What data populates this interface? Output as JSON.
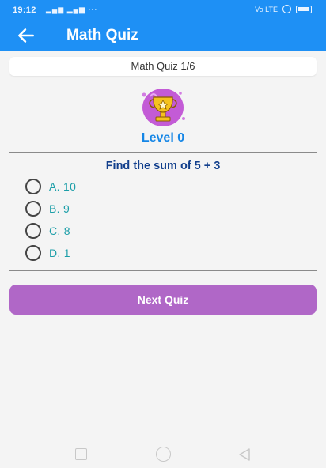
{
  "status_bar": {
    "time": "19:12",
    "network": "Vo LTE"
  },
  "app_bar": {
    "title": "Math Quiz"
  },
  "progress": {
    "label": "Math Quiz 1/6"
  },
  "level": {
    "label": "Level 0"
  },
  "question": {
    "text": "Find the sum of 5 + 3"
  },
  "options": [
    {
      "label": "A. 10"
    },
    {
      "label": "B. 9"
    },
    {
      "label": "C. 8"
    },
    {
      "label": "D. 1"
    }
  ],
  "next_button": {
    "label": "Next Quiz"
  },
  "colors": {
    "primary": "#1e90f5",
    "level": "#1586e6",
    "question": "#123f8c",
    "option": "#1b9ea8",
    "button": "#b067c7"
  },
  "icons": {
    "back": "arrow-left-icon",
    "trophy": "trophy-icon"
  }
}
